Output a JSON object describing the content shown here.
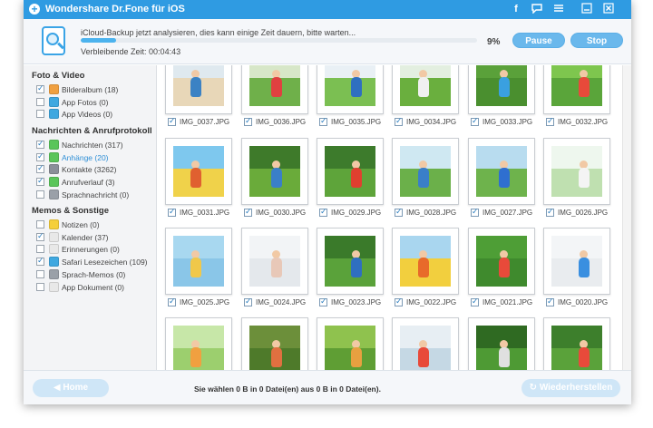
{
  "app": {
    "title": "Wondershare Dr.Fone für iOS",
    "titlebar_icons": [
      "facebook-icon",
      "feedback-icon",
      "menu-icon",
      "minimize-icon",
      "close-icon"
    ]
  },
  "progress": {
    "status": "iCloud-Backup jetzt analysieren, dies kann einige Zeit dauern, bitte warten...",
    "remaining": "Verbleibende Zeit: 00:04:43",
    "percent_label": "9%",
    "percent_value": 9,
    "pause_label": "Pause",
    "stop_label": "Stop"
  },
  "sidebar": {
    "categories": [
      {
        "title": "Foto & Video",
        "items": [
          {
            "label": "Bilderalbum (18)",
            "checked": true,
            "icon": "photo-album-icon",
            "color": "#f0a040"
          },
          {
            "label": "App Fotos (0)",
            "checked": false,
            "icon": "app-photos-icon",
            "color": "#3fa8e0"
          },
          {
            "label": "App Videos (0)",
            "checked": false,
            "icon": "app-videos-icon",
            "color": "#3fa8e0"
          }
        ]
      },
      {
        "title": "Nachrichten & Anrufprotokoll",
        "items": [
          {
            "label": "Nachrichten (317)",
            "checked": true,
            "icon": "messages-icon",
            "color": "#5ac55a"
          },
          {
            "label": "Anhänge (20)",
            "checked": true,
            "icon": "attachments-icon",
            "color": "#5ac55a",
            "active": true
          },
          {
            "label": "Kontakte (3262)",
            "checked": true,
            "icon": "contacts-icon",
            "color": "#8a8f99"
          },
          {
            "label": "Anrufverlauf (3)",
            "checked": true,
            "icon": "call-history-icon",
            "color": "#5ac55a"
          },
          {
            "label": "Sprachnachricht (0)",
            "checked": false,
            "icon": "voicemail-icon",
            "color": "#9aa0a8"
          }
        ]
      },
      {
        "title": "Memos & Sonstige",
        "items": [
          {
            "label": "Notizen (0)",
            "checked": false,
            "icon": "notes-icon",
            "color": "#f5cf3a"
          },
          {
            "label": "Kalender (37)",
            "checked": true,
            "icon": "calendar-icon",
            "color": "#e8e8e8"
          },
          {
            "label": "Erinnerungen (0)",
            "checked": false,
            "icon": "reminders-icon",
            "color": "#e8e8e8"
          },
          {
            "label": "Safari Lesezeichen (109)",
            "checked": true,
            "icon": "safari-icon",
            "color": "#3fa8e0"
          },
          {
            "label": "Sprach-Memos (0)",
            "checked": false,
            "icon": "voice-memos-icon",
            "color": "#9aa0a8"
          },
          {
            "label": "App Dokument (0)",
            "checked": false,
            "icon": "app-document-icon",
            "color": "#e8e8e8"
          }
        ]
      }
    ]
  },
  "grid": {
    "rows": [
      [
        "IMG_0037.JPG",
        "IMG_0036.JPG",
        "IMG_0035.JPG",
        "IMG_0034.JPG",
        "IMG_0033.JPG",
        "IMG_0032.JPG"
      ],
      [
        "IMG_0031.JPG",
        "IMG_0030.JPG",
        "IMG_0029.JPG",
        "IMG_0028.JPG",
        "IMG_0027.JPG",
        "IMG_0026.JPG"
      ],
      [
        "IMG_0025.JPG",
        "IMG_0024.JPG",
        "IMG_0023.JPG",
        "IMG_0022.JPG",
        "IMG_0021.JPG",
        "IMG_0020.JPG"
      ],
      [
        "",
        "",
        "",
        "",
        "",
        ""
      ]
    ],
    "palettes": [
      [
        "#dfe9ef",
        "#e8d7b8",
        "#3b82c4"
      ],
      [
        "#d7e7c8",
        "#6fb04a",
        "#e04040"
      ],
      [
        "#e9f0f5",
        "#7bbf52",
        "#2f6fc0"
      ],
      [
        "#e3efe0",
        "#6aaf3e",
        "#f0f0f0"
      ],
      [
        "#5aa13a",
        "#4a8f2f",
        "#3aa0e0"
      ],
      [
        "#7ec64e",
        "#5aa53a",
        "#e84a3a"
      ],
      [
        "#7ec8ee",
        "#f0d24a",
        "#e06030"
      ],
      [
        "#3e7a2a",
        "#6aab3a",
        "#3a7fc8"
      ],
      [
        "#3d7b2c",
        "#5ea43a",
        "#e0402f"
      ],
      [
        "#cfe8f2",
        "#6bb04a",
        "#3a7fc8"
      ],
      [
        "#b8dcef",
        "#6eb34c",
        "#2f6fd0"
      ],
      [
        "#eef7ee",
        "#bfe0b0",
        "#f4f4f4"
      ],
      [
        "#a8d8f0",
        "#8ac6e8",
        "#f0c84a"
      ],
      [
        "#f2f4f6",
        "#e4e8ec",
        "#e8c8b8"
      ],
      [
        "#3a7a2a",
        "#5aa23a",
        "#2f6fc0"
      ],
      [
        "#a9d6ef",
        "#f2cf3e",
        "#e86a2a"
      ],
      [
        "#4e9e36",
        "#3f8a2d",
        "#e84a3a"
      ],
      [
        "#f3f5f7",
        "#e9ecef",
        "#3a8fe0"
      ],
      [
        "#c7e7a8",
        "#9ccf6e",
        "#f0a040"
      ],
      [
        "#6c8f3a",
        "#4e7a2a",
        "#e07040"
      ],
      [
        "#8fc24e",
        "#5f9e34",
        "#e8a040"
      ],
      [
        "#e7eef3",
        "#c5d8e4",
        "#e84a3a"
      ],
      [
        "#2f6a22",
        "#4e9a34",
        "#e0e0e0"
      ],
      [
        "#3d7f2c",
        "#5aa23a",
        "#e84a3a"
      ]
    ]
  },
  "footer": {
    "home_label": "Home",
    "summary": "Sie wählen 0 B in 0 Datei(en) aus 0 B in 0 Datei(en).",
    "restore_label": "Wiederherstellen"
  }
}
